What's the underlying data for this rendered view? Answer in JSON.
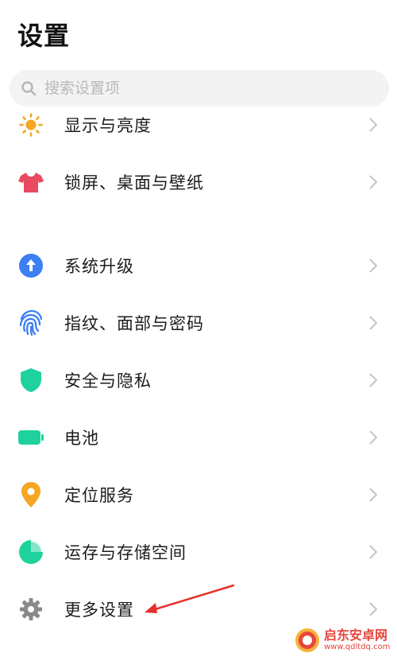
{
  "header": {
    "title": "设置"
  },
  "search": {
    "placeholder": "搜索设置项",
    "icon": "search-icon"
  },
  "colors": {
    "display": "#f5a623",
    "lockscreen": "#e84a5f",
    "update": "#3b7ff2",
    "fingerprint": "#3b7ff2",
    "security": "#1fd19c",
    "battery": "#1fd19c",
    "location": "#f5a623",
    "storage": "#1fd19c",
    "more": "#8a8a8a",
    "annotation": "#e8302a"
  },
  "menu": {
    "items": [
      {
        "id": "display",
        "label": "显示与亮度",
        "icon": "sun-icon"
      },
      {
        "id": "lockscreen",
        "label": "锁屏、桌面与壁纸",
        "icon": "tshirt-icon"
      },
      {
        "id": "update",
        "label": "系统升级",
        "icon": "arrow-up-circle-icon"
      },
      {
        "id": "fingerprint",
        "label": "指纹、面部与密码",
        "icon": "fingerprint-icon"
      },
      {
        "id": "security",
        "label": "安全与隐私",
        "icon": "shield-icon"
      },
      {
        "id": "battery",
        "label": "电池",
        "icon": "battery-icon"
      },
      {
        "id": "location",
        "label": "定位服务",
        "icon": "location-pin-icon"
      },
      {
        "id": "storage",
        "label": "运存与存储空间",
        "icon": "pie-chart-icon"
      },
      {
        "id": "more",
        "label": "更多设置",
        "icon": "gear-icon"
      }
    ]
  },
  "watermark": {
    "name": "启东安卓网",
    "url": "www.qdltdq.com"
  }
}
